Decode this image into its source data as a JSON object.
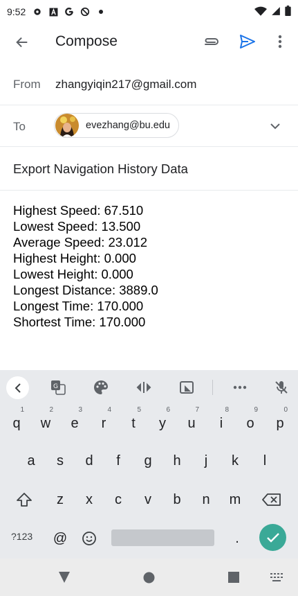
{
  "status_bar": {
    "time": "9:52",
    "icons_left": [
      "gear-icon",
      "a-icon",
      "google-g-icon",
      "blocked-icon",
      "dot-icon"
    ],
    "icons_right": [
      "wifi-icon",
      "signal-icon",
      "battery-icon"
    ]
  },
  "toolbar": {
    "title": "Compose"
  },
  "from": {
    "label": "From",
    "value": "zhangyiqin217@gmail.com"
  },
  "to": {
    "label": "To",
    "recipient": "evezhang@bu.edu"
  },
  "subject": "Export Navigation History Data",
  "body_lines": [
    "Highest Speed: 67.510",
    "Lowest Speed: 13.500",
    "Average Speed: 23.012",
    "Highest Height: 0.000",
    "Lowest Height: 0.000",
    "Longest Distance: 3889.0",
    "Longest Time: 170.000",
    "Shortest Time: 170.000"
  ],
  "keyboard": {
    "row1": [
      {
        "key": "q",
        "hint": "1"
      },
      {
        "key": "w",
        "hint": "2"
      },
      {
        "key": "e",
        "hint": "3"
      },
      {
        "key": "r",
        "hint": "4"
      },
      {
        "key": "t",
        "hint": "5"
      },
      {
        "key": "y",
        "hint": "6"
      },
      {
        "key": "u",
        "hint": "7"
      },
      {
        "key": "i",
        "hint": "8"
      },
      {
        "key": "o",
        "hint": "9"
      },
      {
        "key": "p",
        "hint": "0"
      }
    ],
    "row2": [
      "a",
      "s",
      "d",
      "f",
      "g",
      "h",
      "j",
      "k",
      "l"
    ],
    "row3": [
      "z",
      "x",
      "c",
      "v",
      "b",
      "n",
      "m"
    ],
    "symbols_label": "?123",
    "at_label": "@",
    "period_label": "."
  },
  "colors": {
    "accent": "#1a73e8",
    "enter_key": "#3aa997",
    "keyboard_bg": "#e8eaed"
  }
}
